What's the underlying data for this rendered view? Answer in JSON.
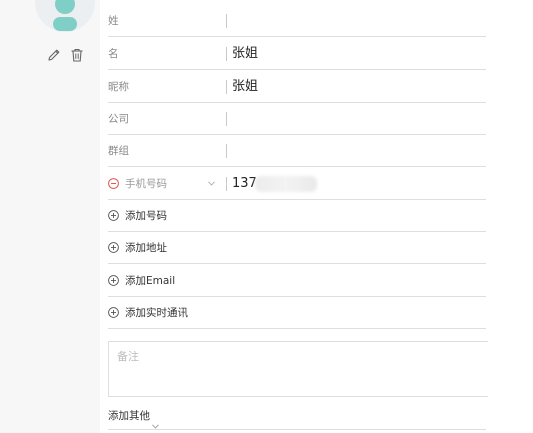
{
  "form": {
    "fields": [
      {
        "label": "姓",
        "value": ""
      },
      {
        "label": "名",
        "value": "张姐"
      },
      {
        "label": "昵称",
        "value": "张姐"
      },
      {
        "label": "公司",
        "value": ""
      },
      {
        "label": "群组",
        "value": ""
      }
    ],
    "phone": {
      "label": "手机号码",
      "value": "137"
    },
    "add_number": "添加号码",
    "add_address": "添加地址",
    "add_email": "添加Email",
    "add_im": "添加实时通讯",
    "notes_placeholder": "备注",
    "add_other": "添加其他"
  },
  "colors": {
    "accent_red": "#e05a4f",
    "divider": "#dedede",
    "label": "#8a8a8a"
  },
  "icons": [
    "avatar-icon",
    "edit-pencil-icon",
    "delete-trash-icon",
    "remove-circle-icon",
    "add-circle-icon",
    "chevron-down-icon"
  ]
}
